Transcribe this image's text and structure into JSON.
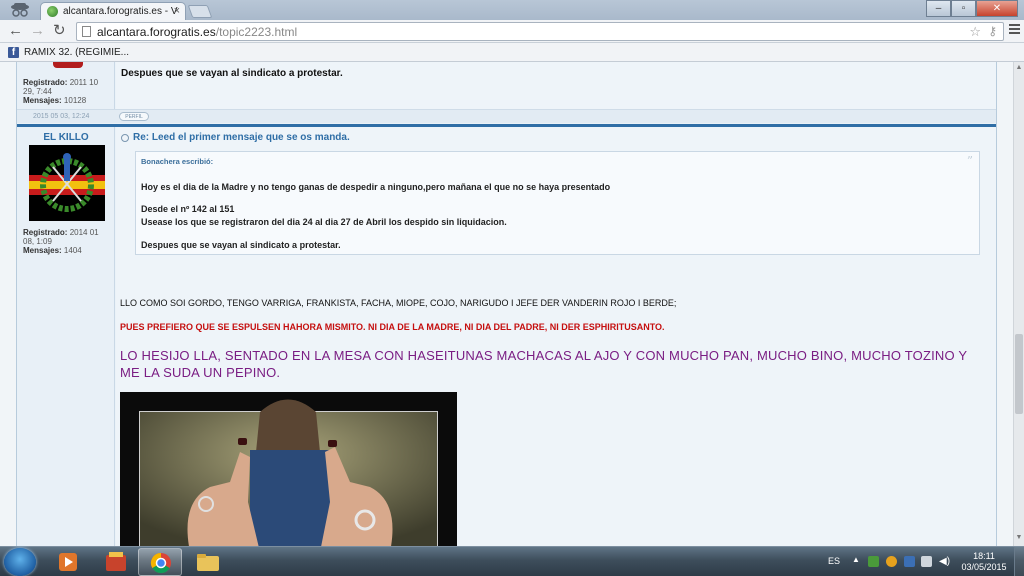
{
  "browser": {
    "tab_title": "alcantara.forogratis.es - V",
    "url_host": "alcantara.forogratis.es",
    "url_path": "/topic2223.html",
    "bookmark_label": "RAMIX 32. (REGIMIE..."
  },
  "prev_post": {
    "reg_label": "Registrado:",
    "reg_value": "2011 10 29, 7:44",
    "msgs_label": "Mensajes:",
    "msgs_value": "10128",
    "text": "Despues que se vayan al sindicato a protestar.",
    "date": "2015 05 03, 12:24",
    "perfil": "PERFIL"
  },
  "post": {
    "author": "EL KILLO",
    "reg_label": "Registrado:",
    "reg_value": "2014 01 08, 1:09",
    "msgs_label": "Mensajes:",
    "msgs_value": "1404",
    "title": "Re: Leed el primer mensaje que se os manda.",
    "quote": {
      "header": "Bonachera escribió:",
      "line1": "Hoy es el dia de la Madre y no tengo ganas de despedir a ninguno,pero mañana el que no se haya presentado",
      "line2": "Desde el nº 142 al 151",
      "line3": "Usease los que se registraron del dia 24 al dia 27 de Abril los despido sin liquidacion.",
      "line4": "Despues que se vayan al sindicato a protestar."
    },
    "text1": "LLO COMO SOI GORDO, TENGO VARRIGA, FRANKISTA, FACHA, MIOPE, COJO, NARIGUDO I JEFE DER VANDERIN ROJO I BERDE;",
    "text2": "PUES PREFIERO QUE SE ESPULSEN HAHORA MISMITO. NI DIA DE LA MADRE, NI DIA DEL PADRE, NI DER ESPHIRITUSANTO.",
    "text3": "LO HESIJO LLA, SENTADO EN LA MESA CON HASEITUNAS MACHACAS AL AJO Y CON MUCHO PAN, MUCHO BINO, MUCHO TOZINO Y ME LA SUDA UN PEPINO."
  },
  "taskbar": {
    "lang": "ES",
    "time": "18:11",
    "date": "03/05/2015"
  }
}
